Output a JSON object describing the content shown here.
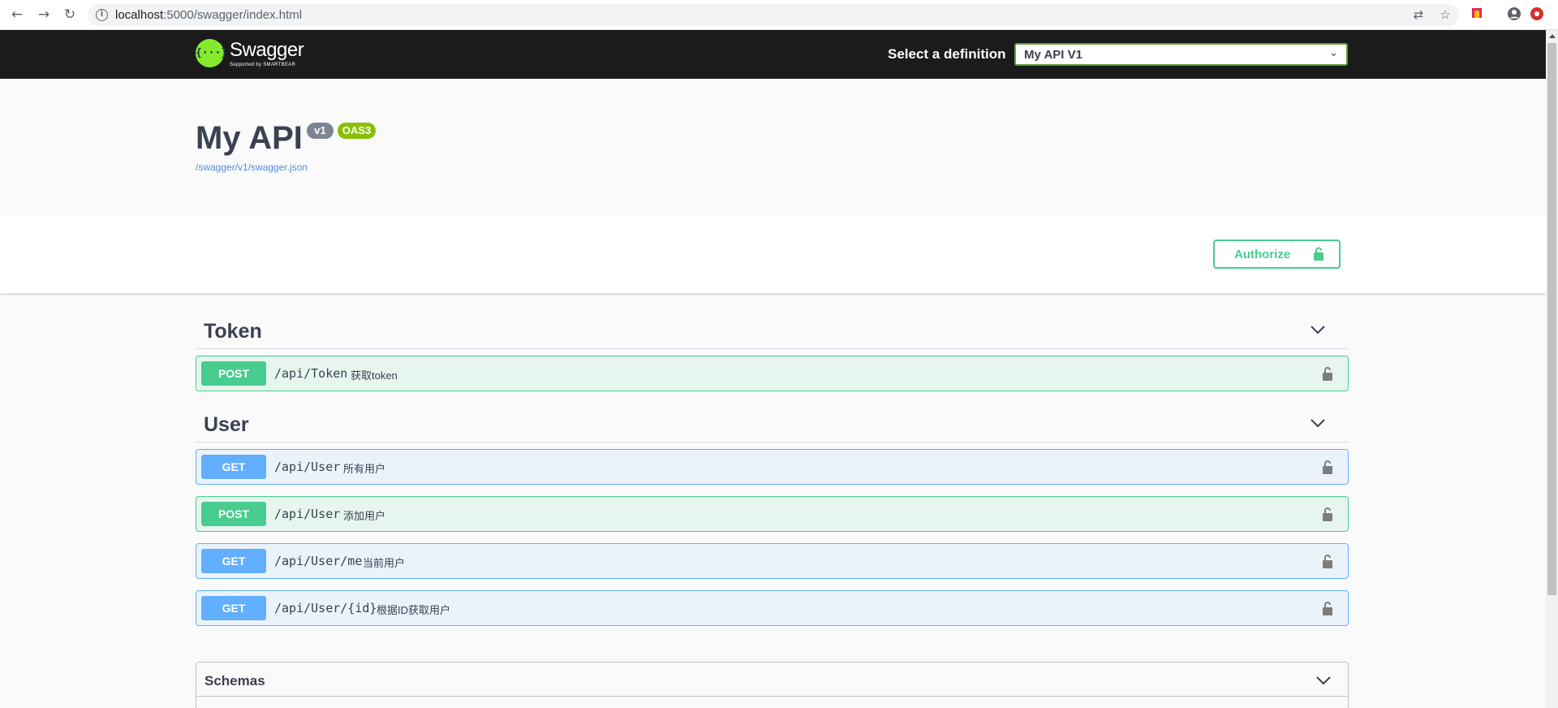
{
  "browser": {
    "back_icon": "arrow-left-icon",
    "forward_icon": "arrow-right-icon",
    "reload_icon": "reload-icon",
    "url_host": "localhost",
    "url_rest": ":5000/swagger/index.html"
  },
  "topbar": {
    "logo_text": "Swagger",
    "logo_mark": "{···}",
    "logo_sub": "Supported by SMARTBEAR",
    "definition_label": "Select a definition",
    "definition_value": "My API V1"
  },
  "info": {
    "title": "My API",
    "version": "v1",
    "oas": "OAS3",
    "spec_url": "/swagger/v1/swagger.json"
  },
  "authorize": {
    "label": "Authorize"
  },
  "tags": [
    {
      "name": "Token",
      "operations": [
        {
          "method": "POST",
          "path": "/api/Token",
          "summary": "获取token"
        }
      ]
    },
    {
      "name": "User",
      "operations": [
        {
          "method": "GET",
          "path": "/api/User",
          "summary": "所有用户"
        },
        {
          "method": "POST",
          "path": "/api/User",
          "summary": "添加用户"
        },
        {
          "method": "GET",
          "path": "/api/User/me",
          "summary": "当前用户"
        },
        {
          "method": "GET",
          "path": "/api/User/{id}",
          "summary": "根据ID获取用户"
        }
      ]
    }
  ],
  "schemas": {
    "title": "Schemas"
  },
  "colors": {
    "post": "#49cc90",
    "get": "#61affe",
    "topbar": "#1b1b1b",
    "swagger_green": "#85ea2d",
    "oas_badge": "#89bf04"
  }
}
